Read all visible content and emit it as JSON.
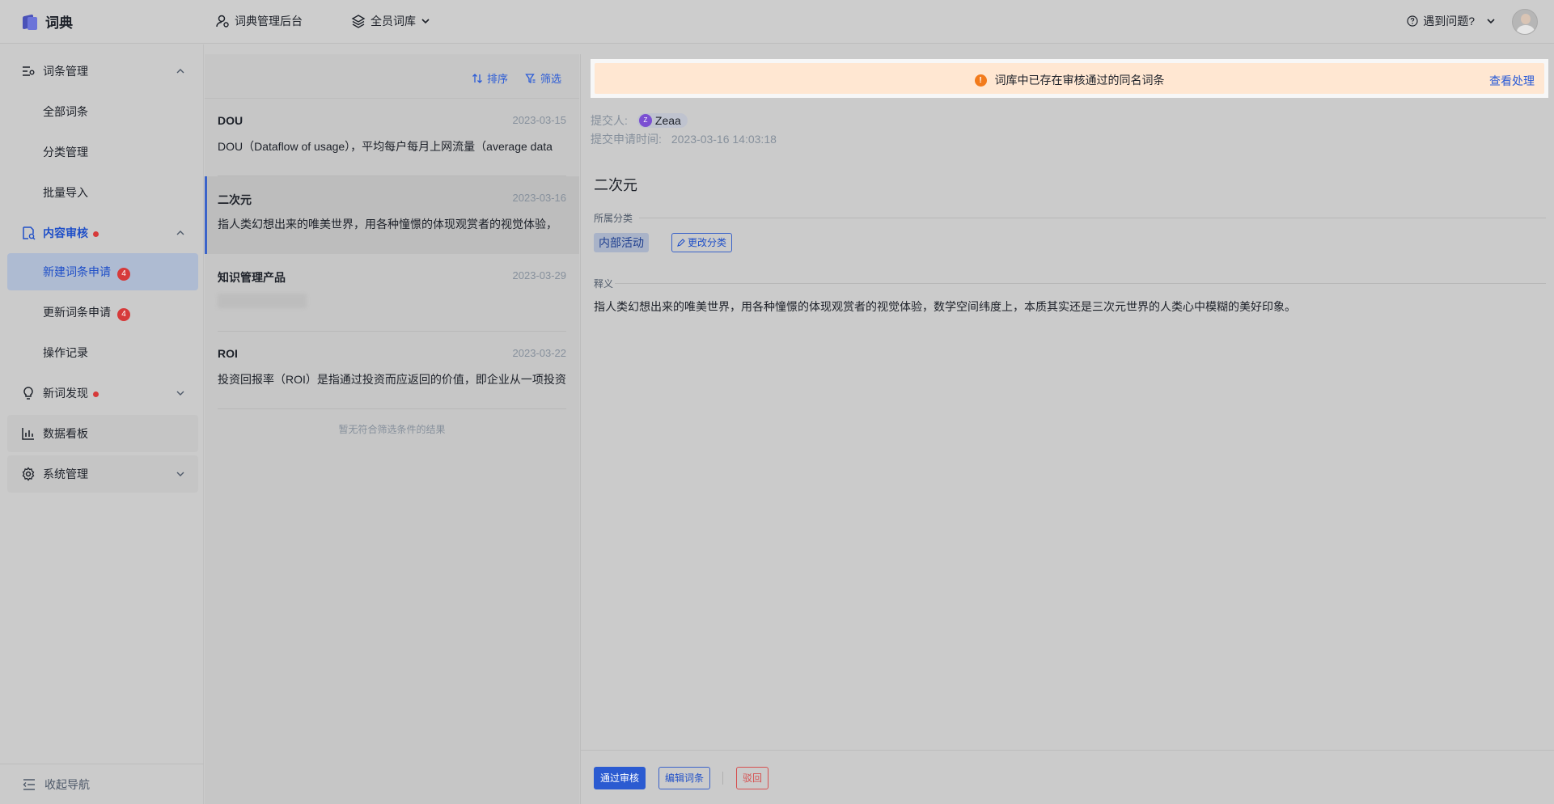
{
  "app": {
    "name": "词典"
  },
  "topbar": {
    "admin_label": "词典管理后台",
    "library_label": "全员词库",
    "help_label": "遇到问题?"
  },
  "sidebar": {
    "groups": [
      {
        "label": "词条管理",
        "expanded": true,
        "items": [
          "全部词条",
          "分类管理",
          "批量导入"
        ]
      },
      {
        "label": "内容审核",
        "expanded": true,
        "has_dot": true,
        "items": [
          {
            "label": "新建词条申请",
            "badge": "4",
            "selected": true
          },
          {
            "label": "更新词条申请",
            "badge": "4"
          },
          {
            "label": "操作记录"
          }
        ]
      },
      {
        "label": "新词发现",
        "expanded": false,
        "has_dot": true
      },
      {
        "label": "数据看板"
      },
      {
        "label": "系统管理",
        "expanded": false
      }
    ],
    "collapse_label": "收起导航"
  },
  "list": {
    "sort_label": "排序",
    "filter_label": "筛选",
    "items": [
      {
        "title": "DOU",
        "date": "2023-03-15",
        "desc": "DOU（Dataflow of usage），平均每户每月上网流量（average data"
      },
      {
        "title": "二次元",
        "date": "2023-03-16",
        "desc": "指人类幻想出来的唯美世界，用各种憧憬的体现观赏者的视觉体验，",
        "selected": true
      },
      {
        "title": "知识管理产品",
        "date": "2023-03-29",
        "desc": ""
      },
      {
        "title": "ROI",
        "date": "2023-03-22",
        "desc": "投资回报率（ROI）是指通过投资而应返回的价值，即企业从一项投资"
      }
    ],
    "empty_text": "暂无符合筛选条件的结果"
  },
  "detail": {
    "alert_text": "词库中已存在审核通过的同名词条",
    "alert_link": "查看处理",
    "submitter_label": "提交人:",
    "submitter_name": "Zeaa",
    "submitter_initial": "Z",
    "submit_time_label": "提交申请时间:",
    "submit_time": "2023-03-16 14:03:18",
    "term": "二次元",
    "category_label": "所属分类",
    "category_tag": "内部活动",
    "change_category": "更改分类",
    "definition_label": "释义",
    "definition": "指人类幻想出来的唯美世界，用各种憧憬的体现观赏者的视觉体验，数学空间纬度上，本质其实还是三次元世界的人类心中模糊的美好印象。",
    "approve_btn": "通过审核",
    "edit_btn": "编辑词条",
    "reject_btn": "驳回"
  },
  "colors": {
    "accent": "#2b5bd1",
    "alert_bg": "#ffe7d2",
    "warn": "#f27b1c",
    "badge": "#d63a3a"
  }
}
